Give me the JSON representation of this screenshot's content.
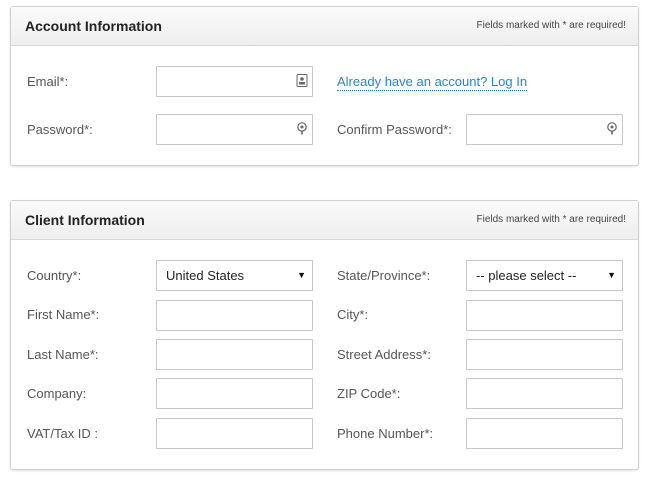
{
  "account": {
    "title": "Account Information",
    "required_note": "Fields marked with * are required!",
    "email_label": "Email*:",
    "password_label": "Password*:",
    "confirm_password_label": "Confirm Password*:",
    "login_link": "Already have an account? Log In"
  },
  "client": {
    "title": "Client Information",
    "required_note": "Fields marked with * are required!",
    "country_label": "Country*:",
    "country_value": "United States",
    "state_label": "State/Province*:",
    "state_value": "-- please select --",
    "first_name_label": "First Name*:",
    "city_label": "City*:",
    "last_name_label": "Last Name*:",
    "street_label": "Street Address*:",
    "company_label": "Company:",
    "zip_label": "ZIP Code*:",
    "vat_label": "VAT/Tax ID :",
    "phone_label": "Phone Number*:",
    "dropdown_arrow": "▼"
  },
  "icons": {
    "email_field": "contact-card-icon",
    "password_field": "password-key-icon"
  },
  "colors": {
    "link": "#2a86c4",
    "border": "#c8c8c8"
  }
}
